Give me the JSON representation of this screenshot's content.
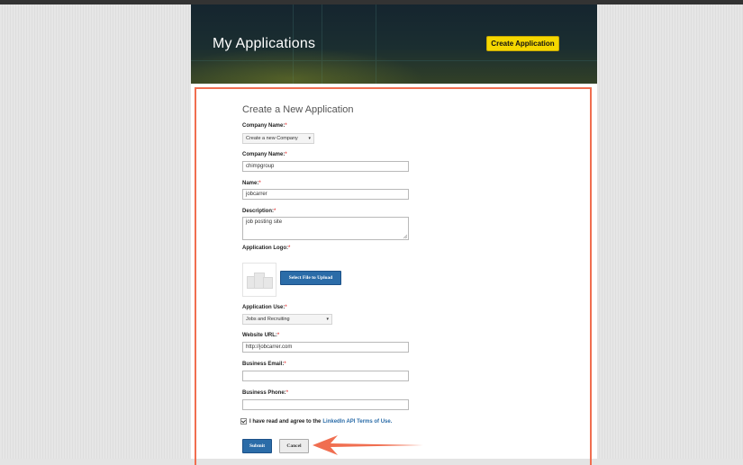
{
  "header": {
    "title": "My Applications",
    "create_button": "Create Application"
  },
  "form": {
    "title": "Create a New Application",
    "company_select_label": "Company Name:",
    "company_select_value": "Create a new Company",
    "company_name_label": "Company Name:",
    "company_name_value": "chimpgroup",
    "name_label": "Name:",
    "name_value": "jobcarrer",
    "description_label": "Description:",
    "description_value": "job posting site",
    "logo_label": "Application Logo:",
    "upload_button": "Select File to Upload",
    "app_use_label": "Application Use:",
    "app_use_value": "Jobs and Recruiting",
    "website_label": "Website URL:",
    "website_value": "http://jobcarrer.com",
    "email_label": "Business Email:",
    "email_value": "",
    "phone_label": "Business Phone:",
    "phone_value": "",
    "required_mark": "*",
    "agree_text": "I have read and agree to the",
    "agree_link": "LinkedIn API Terms of Use.",
    "submit": "Submit",
    "cancel": "Cancel"
  },
  "colors": {
    "accent_yellow": "#f5d700",
    "primary_blue": "#2b6ca8",
    "highlight_red": "#f06e50"
  }
}
